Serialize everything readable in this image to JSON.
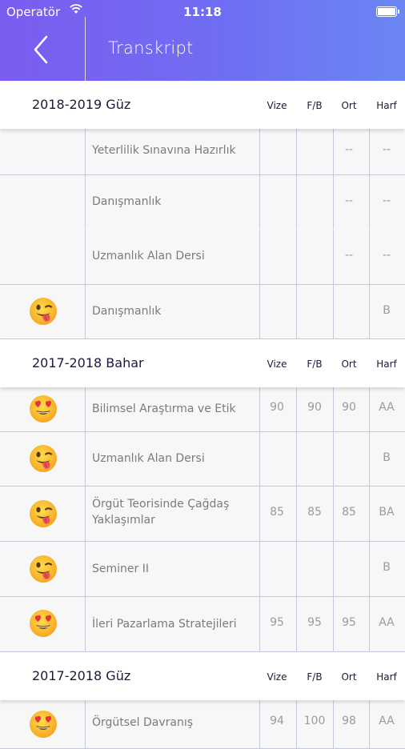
{
  "status": {
    "carrier": "Operatör",
    "time": "11:18"
  },
  "header": {
    "title": "Transkript"
  },
  "columns": {
    "vize": "Vize",
    "fb": "F/B",
    "ort": "Ort",
    "harf": "Harf"
  },
  "sections": [
    {
      "title": "2018-2019 Güz",
      "rows": [
        {
          "course": "Yeterlilik Sınavına Hazırlık",
          "vize": "",
          "fb": "",
          "ort": "--",
          "harf": "--"
        },
        {
          "course": "Danışmanlık",
          "vize": "",
          "fb": "",
          "ort": "--",
          "harf": "--"
        },
        {
          "course": "Uzmanlık Alan Dersi",
          "vize": "",
          "fb": "",
          "ort": "--",
          "harf": "--"
        },
        {
          "course": "Danışmanlık",
          "vize": "",
          "fb": "",
          "ort": "",
          "harf": "B",
          "emoji": "tongue-emoji"
        }
      ]
    },
    {
      "title": "2017-2018 Bahar",
      "rows": [
        {
          "course": "Bilimsel Araştırma ve Etik",
          "vize": "90",
          "fb": "90",
          "ort": "90",
          "harf": "AA",
          "emoji": "heart-eyes-emoji"
        },
        {
          "course": "Uzmanlık Alan Dersi",
          "vize": "",
          "fb": "",
          "ort": "",
          "harf": "B",
          "emoji": "tongue-emoji"
        },
        {
          "course": "Örgüt Teorisinde Çağdaş Yaklaşımlar",
          "vize": "85",
          "fb": "85",
          "ort": "85",
          "harf": "BA",
          "emoji": "tongue-emoji"
        },
        {
          "course": "Seminer II",
          "vize": "",
          "fb": "",
          "ort": "",
          "harf": "B",
          "emoji": "tongue-emoji"
        },
        {
          "course": "İleri Pazarlama Stratejileri",
          "vize": "95",
          "fb": "95",
          "ort": "95",
          "harf": "AA",
          "emoji": "heart-eyes-emoji"
        }
      ]
    },
    {
      "title": "2017-2018 Güz",
      "rows": [
        {
          "course": "Örgütsel Davranış",
          "vize": "94",
          "fb": "100",
          "ort": "98",
          "harf": "AA",
          "emoji": "heart-eyes-emoji"
        }
      ]
    }
  ]
}
